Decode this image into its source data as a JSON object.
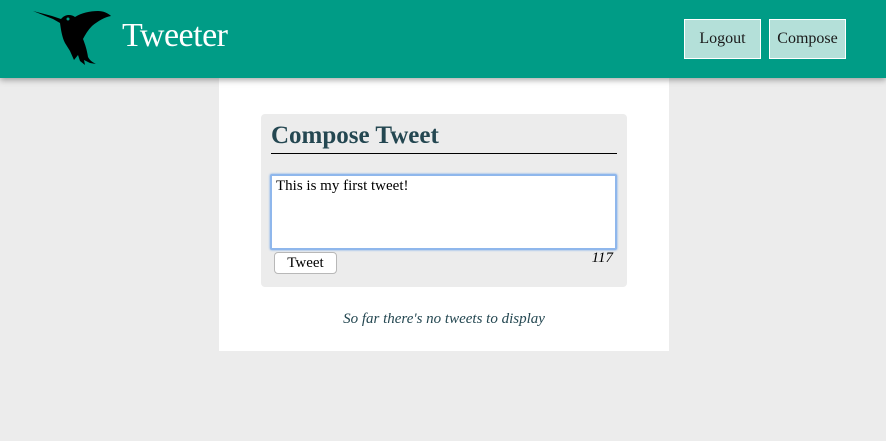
{
  "navbar": {
    "brand": "Tweeter",
    "logout_label": "Logout",
    "compose_label": "Compose"
  },
  "compose": {
    "title": "Compose Tweet",
    "text_value": "This is my first tweet!",
    "tweet_button_label": "Tweet",
    "char_counter": "117"
  },
  "feed": {
    "empty_message": "So far there's no tweets to display"
  },
  "icons": {
    "logo": "hummingbird-icon"
  },
  "colors": {
    "navbar": "#009c86",
    "nav_button": "#b4e0d9",
    "title_text": "#244751",
    "page_background": "#ececec"
  }
}
